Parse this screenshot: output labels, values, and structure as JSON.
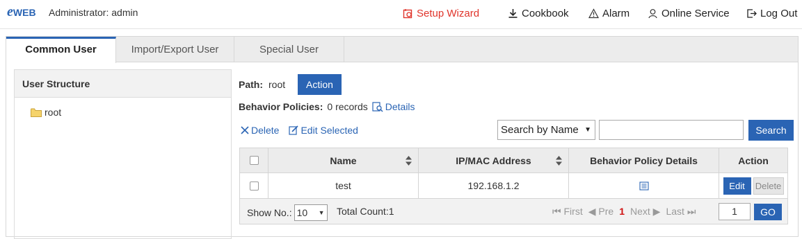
{
  "header": {
    "logo_e": "e",
    "logo_text": "WEB",
    "admin": "Administrator: admin",
    "nav": [
      {
        "label": "Setup Wizard"
      },
      {
        "label": "Cookbook"
      },
      {
        "label": "Alarm"
      },
      {
        "label": "Online Service"
      },
      {
        "label": "Log Out"
      }
    ]
  },
  "tabs": [
    "Common User",
    "Import/Export User",
    "Special User"
  ],
  "left": {
    "title": "User Structure",
    "root": "root"
  },
  "path": {
    "label": "Path:",
    "value": "root",
    "action": "Action"
  },
  "policies": {
    "label": "Behavior Policies:",
    "value": "0 records",
    "details": "Details"
  },
  "ops": {
    "delete": "Delete",
    "edit_selected": "Edit Selected"
  },
  "search": {
    "mode": "Search by Name",
    "query": "",
    "button": "Search"
  },
  "table": {
    "columns": [
      "Name",
      "IP/MAC Address",
      "Behavior Policy Details",
      "Action"
    ],
    "rows": [
      {
        "name": "test",
        "ip": "192.168.1.2",
        "edit": "Edit",
        "delete": "Delete"
      }
    ]
  },
  "pager": {
    "show_label": "Show No.:",
    "page_size": "10",
    "total": "Total Count:1",
    "first": "First",
    "prev": "Pre",
    "current": "1",
    "next": "Next",
    "last": "Last",
    "page_input": "1",
    "go": "GO"
  },
  "colors": {
    "accent": "#2a64b4",
    "wizard": "#e0342b",
    "current_page": "#d01010"
  }
}
